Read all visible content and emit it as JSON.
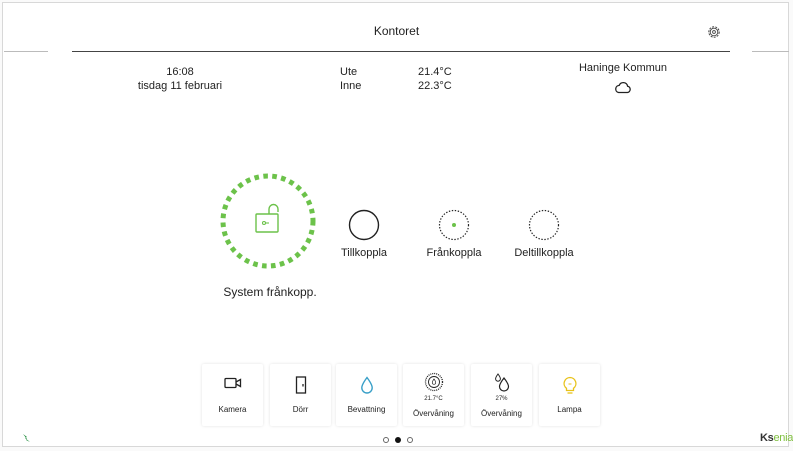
{
  "header": {
    "title": "Kontoret",
    "settings_icon": "gear-icon"
  },
  "datetime": {
    "time": "16:08",
    "date": "tisdag 11 februari"
  },
  "weather": {
    "outside_label": "Ute",
    "outside_temp": "21.4°C",
    "inside_label": "Inne",
    "inside_temp": "22.3°C",
    "location": "Haninge Kommun",
    "icon": "cloud-icon"
  },
  "system": {
    "status_label": "System frånkopp.",
    "accent_color": "#6cc24a"
  },
  "modes": [
    {
      "label": "Tillkoppla"
    },
    {
      "label": "Frånkoppla"
    },
    {
      "label": "Deltillkoppla"
    }
  ],
  "tiles": [
    {
      "label": "Kamera",
      "icon": "camera-icon"
    },
    {
      "label": "Dörr",
      "icon": "door-icon"
    },
    {
      "label": "Bevattning",
      "icon": "water-drop-icon",
      "color": "#3aa0c8"
    },
    {
      "label": "Övervåning",
      "value": "21.7°C",
      "icon": "thermostat-icon"
    },
    {
      "label": "Övervåning",
      "value": "27%",
      "icon": "humidity-icon"
    },
    {
      "label": "Lampa",
      "icon": "bulb-icon",
      "color": "#e8c21a"
    }
  ],
  "pagination": {
    "pages": 3,
    "current": 2
  },
  "brand": {
    "logo_main": "Ks",
    "logo_accent": "enia"
  }
}
